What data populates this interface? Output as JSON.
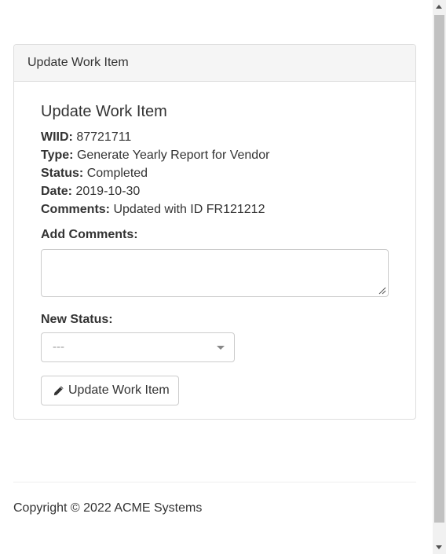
{
  "panel": {
    "heading": "Update Work Item"
  },
  "work_item": {
    "title": "Update Work Item",
    "wiid_label": "WIID:",
    "wiid": "87721711",
    "type_label": "Type:",
    "type": "Generate Yearly Report for Vendor",
    "status_label": "Status:",
    "status": "Completed",
    "date_label": "Date:",
    "date": "2019-10-30",
    "comments_label": "Comments:",
    "comments": "Updated with ID FR121212"
  },
  "form": {
    "add_comments_label": "Add Comments:",
    "add_comments_value": "",
    "new_status_label": "New Status:",
    "new_status_selected": "---",
    "submit_label": "Update Work Item",
    "submit_icon": "pencil-icon"
  },
  "footer": {
    "copyright": "Copyright © 2022 ACME Systems"
  },
  "colors": {
    "panel_heading_bg": "#f5f5f5",
    "border": "#dddddd",
    "input_border": "#cccccc",
    "text": "#333333",
    "placeholder": "#999999",
    "scroll_thumb": "#c1c1c1"
  }
}
